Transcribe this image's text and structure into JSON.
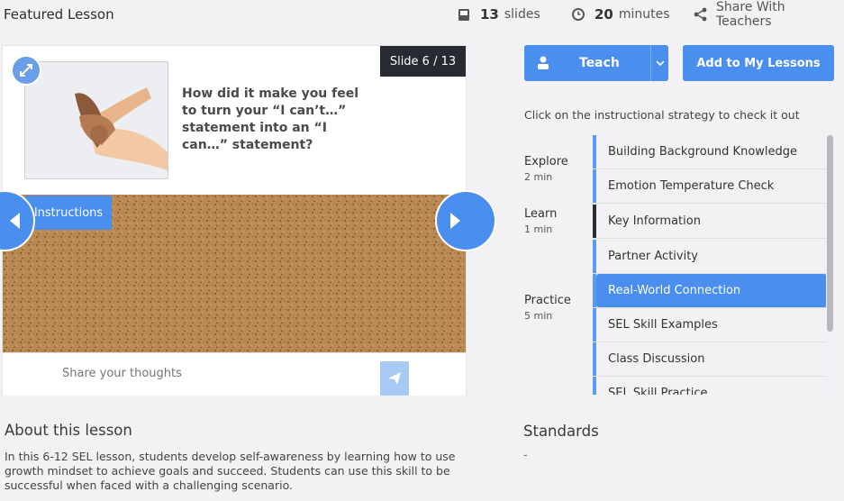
{
  "header": {
    "title": "Featured Lesson",
    "slides_count": "13",
    "slides_label": "slides",
    "minutes_count": "20",
    "minutes_label": "minutes",
    "share_label": "Share With Teachers"
  },
  "slide": {
    "badge": "Slide 6 / 13",
    "question": "How did it make you feel to turn your “I can’t…” statement into an “I can…” statement?",
    "instructions_tab": "Instructions",
    "share_placeholder": "Share your thoughts"
  },
  "actions": {
    "teach_label": "Teach",
    "add_label": "Add to My Lessons"
  },
  "strategy_hint": "Click on the instructional strategy to check it out",
  "phases": [
    {
      "name": "Explore",
      "duration": "2 min"
    },
    {
      "name": "Learn",
      "duration": "1 min"
    },
    {
      "name": "Practice",
      "duration": "5 min"
    }
  ],
  "strategies": [
    {
      "label": "Building Background Knowledge"
    },
    {
      "label": "Emotion Temperature Check"
    },
    {
      "label": "Key Information"
    },
    {
      "label": "Partner Activity"
    },
    {
      "label": "Real-World Connection"
    },
    {
      "label": "SEL Skill Examples"
    },
    {
      "label": "Class Discussion"
    },
    {
      "label": "SEL Skill Practice"
    }
  ],
  "about": {
    "title": "About this lesson",
    "text": "In this 6-12 SEL lesson, students develop self-awareness by learning how to use growth mindset to achieve goals and succeed. Students can use this skill to be successful when faced with a challenging scenario."
  },
  "standards": {
    "title": "Standards",
    "value": "-"
  },
  "colors": {
    "accent": "#4a8ef0",
    "dark_badge": "#252b31",
    "cork": "#b98a52"
  }
}
